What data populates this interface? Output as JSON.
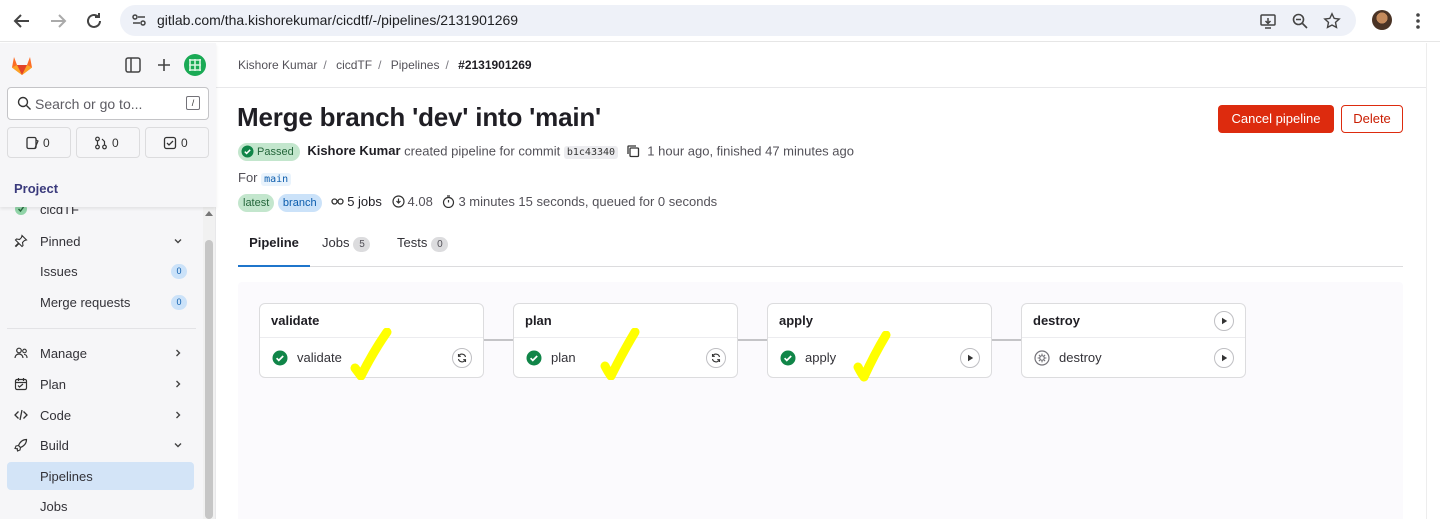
{
  "browser": {
    "url": "gitlab.com/tha.kishorekumar/cicdtf/-/pipelines/2131901269",
    "icons": [
      "back-arrow-icon",
      "forward-arrow-icon",
      "reload-icon",
      "site-info-icon",
      "install-app-icon",
      "zoom-icon",
      "bookmark-star-icon",
      "profile-avatar",
      "menu-kebab-icon"
    ]
  },
  "sidebar": {
    "search_placeholder": "Search or go to...",
    "search_shortcut": "/",
    "counters": [
      {
        "icon": "issues-icon",
        "value": "0"
      },
      {
        "icon": "merge-request-icon",
        "value": "0"
      },
      {
        "icon": "todo-icon",
        "value": "0"
      }
    ],
    "section_title": "Project",
    "partial_project": "cicdTF",
    "items": [
      {
        "label": "Pinned",
        "icon": "pin-icon",
        "chevron": "down"
      },
      {
        "label": "Issues",
        "count": "0"
      },
      {
        "label": "Merge requests",
        "count": "0"
      },
      {
        "label": "Manage",
        "icon": "users-icon",
        "chevron": "right"
      },
      {
        "label": "Plan",
        "icon": "calendar-icon",
        "chevron": "right"
      },
      {
        "label": "Code",
        "icon": "code-icon",
        "chevron": "right"
      },
      {
        "label": "Build",
        "icon": "rocket-icon",
        "chevron": "down"
      },
      {
        "label": "Pipelines",
        "active": true
      },
      {
        "label": "Jobs"
      }
    ]
  },
  "breadcrumb": [
    "Kishore Kumar",
    "cicdTF",
    "Pipelines",
    "#2131901269"
  ],
  "header": {
    "title": "Merge branch 'dev' into 'main'",
    "cancel_label": "Cancel pipeline",
    "delete_label": "Delete"
  },
  "meta": {
    "status": "Passed",
    "author": "Kishore Kumar",
    "action_text": "created pipeline for commit",
    "commit_sha": "b1c43340",
    "time_text": "1 hour ago, finished 47 minutes ago",
    "for_label": "For",
    "ref": "main",
    "chip_latest": "latest",
    "chip_branch": "branch",
    "jobs_text": "5 jobs",
    "compute": "4.08",
    "duration_text": "3 minutes 15 seconds, queued for 0 seconds"
  },
  "tabs": [
    {
      "label": "Pipeline",
      "active": true
    },
    {
      "label": "Jobs",
      "count": "5"
    },
    {
      "label": "Tests",
      "count": "0"
    }
  ],
  "stages": [
    {
      "name": "validate",
      "job": "validate",
      "job_status": "success",
      "job_action": "retry-icon"
    },
    {
      "name": "plan",
      "job": "plan",
      "job_status": "success",
      "job_action": "retry-icon"
    },
    {
      "name": "apply",
      "job": "apply",
      "job_status": "success",
      "job_action": "play-icon"
    },
    {
      "name": "destroy",
      "job": "destroy",
      "job_status": "manual",
      "job_action": "play-icon",
      "stage_action": "play-icon"
    }
  ],
  "colors": {
    "success": "#108548",
    "danger": "#dd2b0e",
    "link": "#1f75cb",
    "highlight_mark": "#ffff00"
  }
}
